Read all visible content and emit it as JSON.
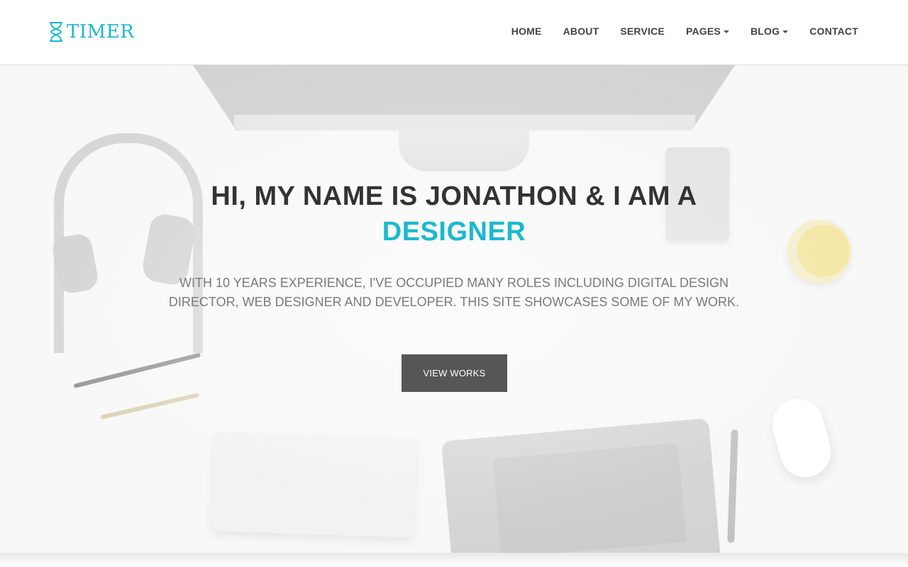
{
  "brand": {
    "name": "TIMER",
    "icon": "hourglass-icon",
    "color": "#1ab9cd"
  },
  "nav": {
    "items": [
      {
        "label": "HOME",
        "has_dropdown": false
      },
      {
        "label": "ABOUT",
        "has_dropdown": false
      },
      {
        "label": "SERVICE",
        "has_dropdown": false
      },
      {
        "label": "PAGES",
        "has_dropdown": true
      },
      {
        "label": "BLOG",
        "has_dropdown": true
      },
      {
        "label": "CONTACT",
        "has_dropdown": false
      }
    ]
  },
  "hero": {
    "title": "HI, MY NAME IS JONATHON & I AM A",
    "title_accent": "DESIGNER",
    "subtitle": "WITH 10 YEARS EXPERIENCE, I'VE OCCUPIED MANY ROLES INCLUDING DIGITAL DESIGN DIRECTOR, WEB DESIGNER AND DEVELOPER. THIS SITE SHOWCASES SOME OF MY WORK.",
    "button_label": "VIEW WORKS"
  },
  "colors": {
    "accent": "#1ab9cd",
    "button_bg": "#565656",
    "text_dark": "#333333"
  }
}
